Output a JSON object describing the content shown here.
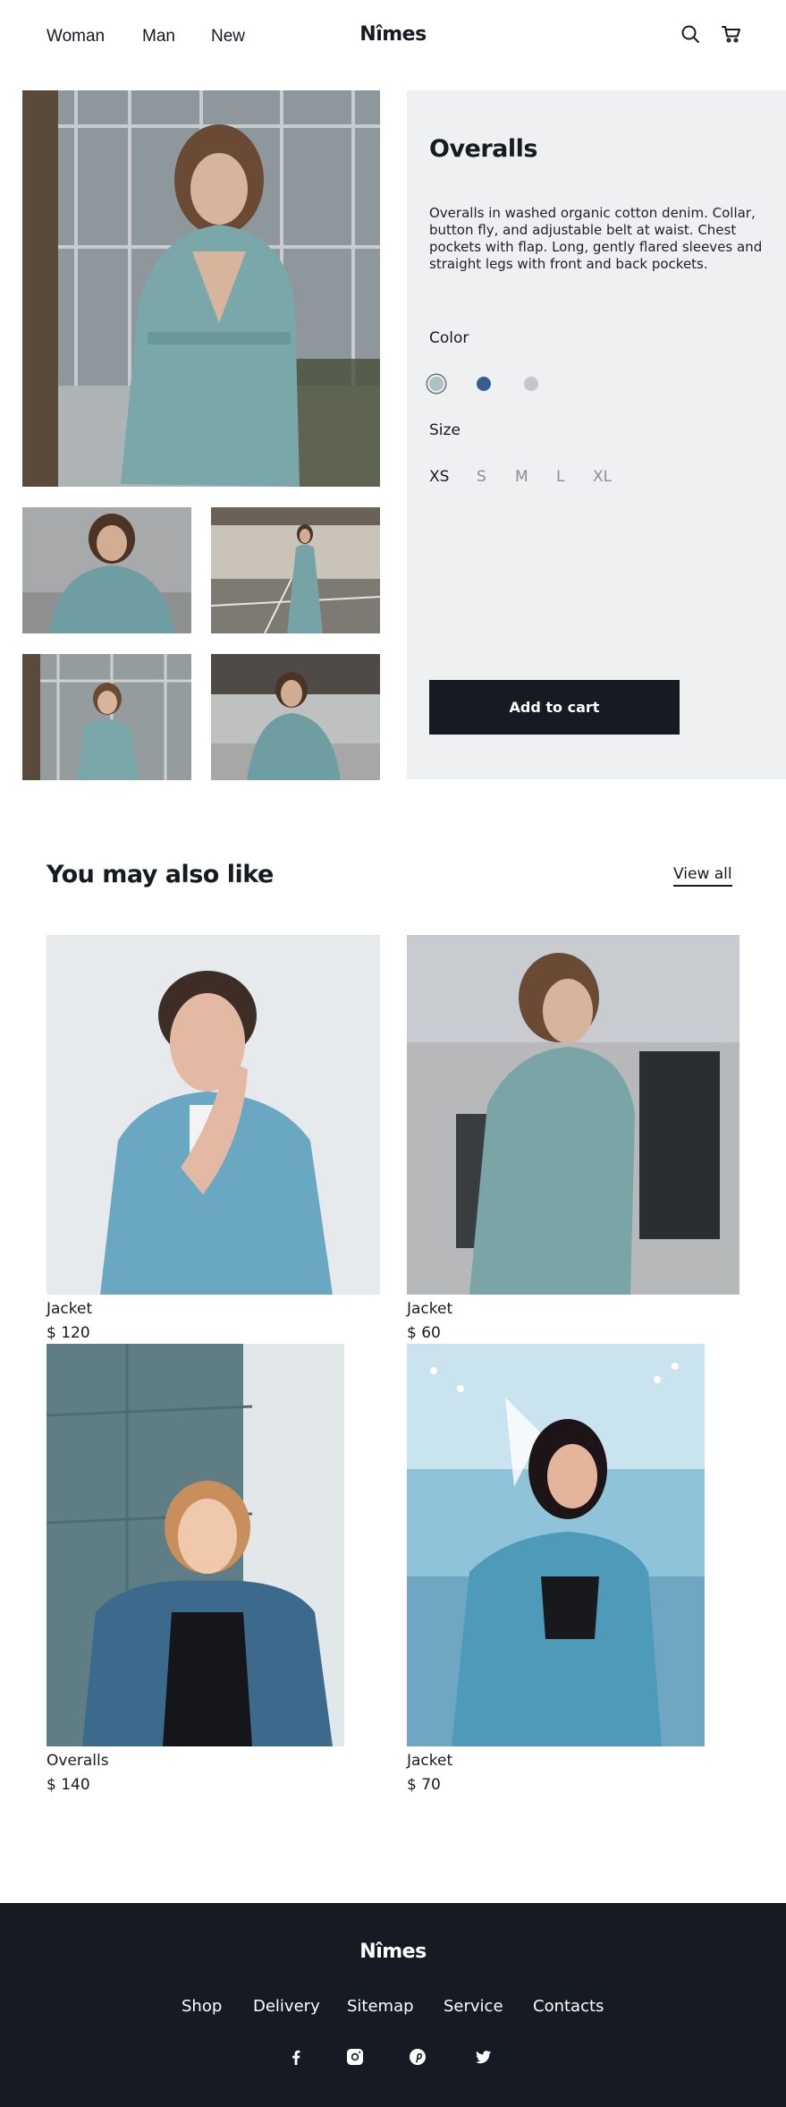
{
  "header": {
    "nav": [
      "Woman",
      "Man",
      "New"
    ],
    "brand": "Nîmes",
    "icons": [
      "search-icon",
      "cart-icon"
    ]
  },
  "product": {
    "title": "Overalls",
    "description": "Overalls in washed organic cotton denim. Collar, button fly, and adjustable belt at waist. Chest pockets with flap. Long, gently flared sleeves and straight legs with front and back pockets.",
    "color_label": "Color",
    "colors": [
      "#a9c3c6",
      "#385d8f",
      "#c4c7ca"
    ],
    "selected_color": 0,
    "size_label": "Size",
    "sizes": [
      "XS",
      "S",
      "M",
      "L",
      "XL"
    ],
    "selected_size": "XS",
    "add_to_cart": "Add to cart"
  },
  "related": {
    "title": "You may also like",
    "view_all": "View all",
    "items": [
      {
        "name": "Jacket",
        "price": "$ 120"
      },
      {
        "name": "Jacket",
        "price": "$ 60"
      },
      {
        "name": "Overalls",
        "price": "$ 140"
      },
      {
        "name": "Jacket",
        "price": "$ 70"
      }
    ]
  },
  "footer": {
    "brand": "Nîmes",
    "links": [
      "Shop",
      "Delivery",
      "Sitemap",
      "Service",
      "Contacts"
    ],
    "social": [
      "facebook-icon",
      "instagram-icon",
      "pinterest-icon",
      "twitter-icon"
    ]
  },
  "colors": {
    "ink": "#161a22",
    "panel": "#eff0f1",
    "footer": "#161a22"
  }
}
